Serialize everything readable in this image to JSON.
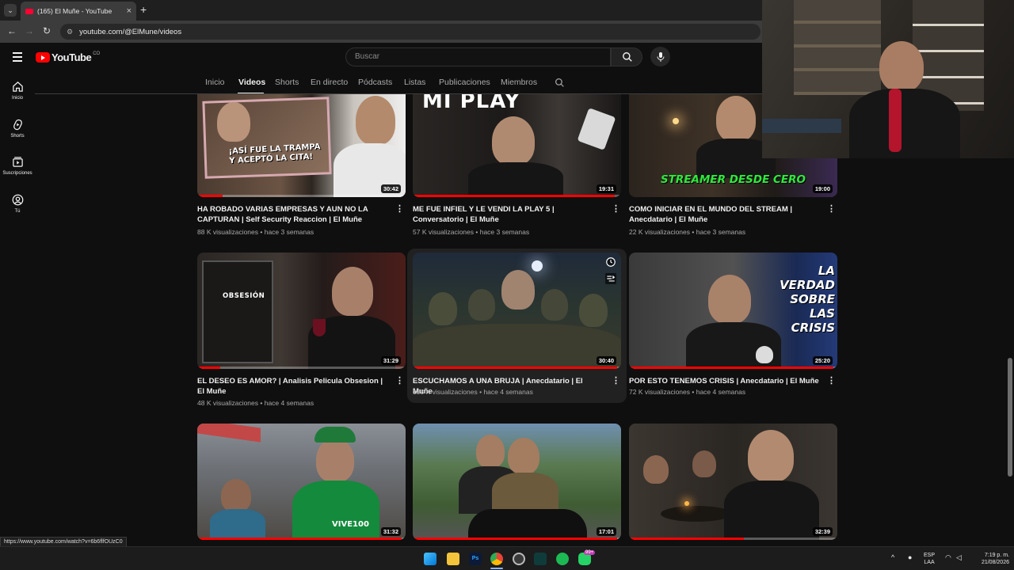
{
  "browser": {
    "tab_title": "(165) El Muñe - YouTube",
    "tab_close": "×",
    "new_tab": "+",
    "url": "youtube.com/@ElMune/videos"
  },
  "header": {
    "logo_text": "YouTube",
    "country_code": "CO",
    "search_placeholder": "Buscar"
  },
  "sidebar": {
    "items": [
      {
        "label": "Inicio",
        "icon": "home-icon"
      },
      {
        "label": "Shorts",
        "icon": "shorts-icon"
      },
      {
        "label": "Suscripciones",
        "icon": "subscriptions-icon"
      },
      {
        "label": "Tú",
        "icon": "you-icon"
      }
    ]
  },
  "channel_tabs": [
    "Inicio",
    "Videos",
    "Shorts",
    "En directo",
    "Pódcasts",
    "Listas",
    "Publicaciones",
    "Miembros"
  ],
  "active_tab": "Videos",
  "videos": [
    {
      "title": "HA ROBADO VARIAS EMPRESAS Y AUN NO LA CAPTURAN | Self Security Reaccion | El Muñe",
      "meta": "88 K visualizaciones • hace 3 semanas",
      "duration": "30:42",
      "overlay": "¡ASÍ FUE LA TRAMPA Y ACEPTÓ LA CITA!",
      "progress": 0.12
    },
    {
      "title": "ME FUE INFIEL Y LE VENDI LA PLAY 5 | Conversatorio | El Muñe",
      "meta": "57 K visualizaciones • hace 3 semanas",
      "duration": "19:31",
      "overlay": "MI PLAY",
      "progress": 0.97
    },
    {
      "title": "COMO INICIAR EN EL MUNDO DEL STREAM | Anecdatario | El Muñe",
      "meta": "22 K visualizaciones • hace 3 semanas",
      "duration": "19:00",
      "overlay": "STREAMER DESDE CERO",
      "progress": 0
    },
    {
      "title": "EL DESEO ES AMOR? | Analisis Pelicula Obsesion | El Muñe",
      "meta": "48 K visualizaciones • hace 4 semanas",
      "duration": "31:29",
      "overlay": "OBSESIÓN",
      "progress": 0.11
    },
    {
      "title": "ESCUCHAMOS A UNA BRUJA | Anecdatario | El Muñe",
      "meta": "158 K visualizaciones • hace 4 semanas",
      "duration": "30:40",
      "overlay": "",
      "progress": 0.98
    },
    {
      "title": "POR ESTO TENEMOS CRISIS | Anecdatario | El Muñe",
      "meta": "72 K visualizaciones • hace 4 semanas",
      "duration": "25:20",
      "overlay": "LA VERDAD SOBRE LAS CRISIS",
      "progress": 0.98
    },
    {
      "title": "",
      "meta": "",
      "duration": "31:32",
      "overlay": "VIVE100",
      "progress": 0.98
    },
    {
      "title": "",
      "meta": "",
      "duration": "17:01",
      "overlay": "",
      "progress": 0.98
    },
    {
      "title": "",
      "meta": "",
      "duration": "32:39",
      "overlay": "",
      "progress": 0.55
    }
  ],
  "more_icon": "⋮",
  "status_url": "https://www.youtube.com/watch?v=6b6flfOUzC0",
  "taskbar": {
    "lang_top": "ESP",
    "lang_bottom": "LAA",
    "time": "7:19 p. m.",
    "date": "21/08/2026",
    "badge": "99+"
  },
  "colors": {
    "background": "#0f0f0f",
    "accent": "#ff0000",
    "text": "#f1f1f1",
    "secondary_text": "#aaaaaa"
  }
}
